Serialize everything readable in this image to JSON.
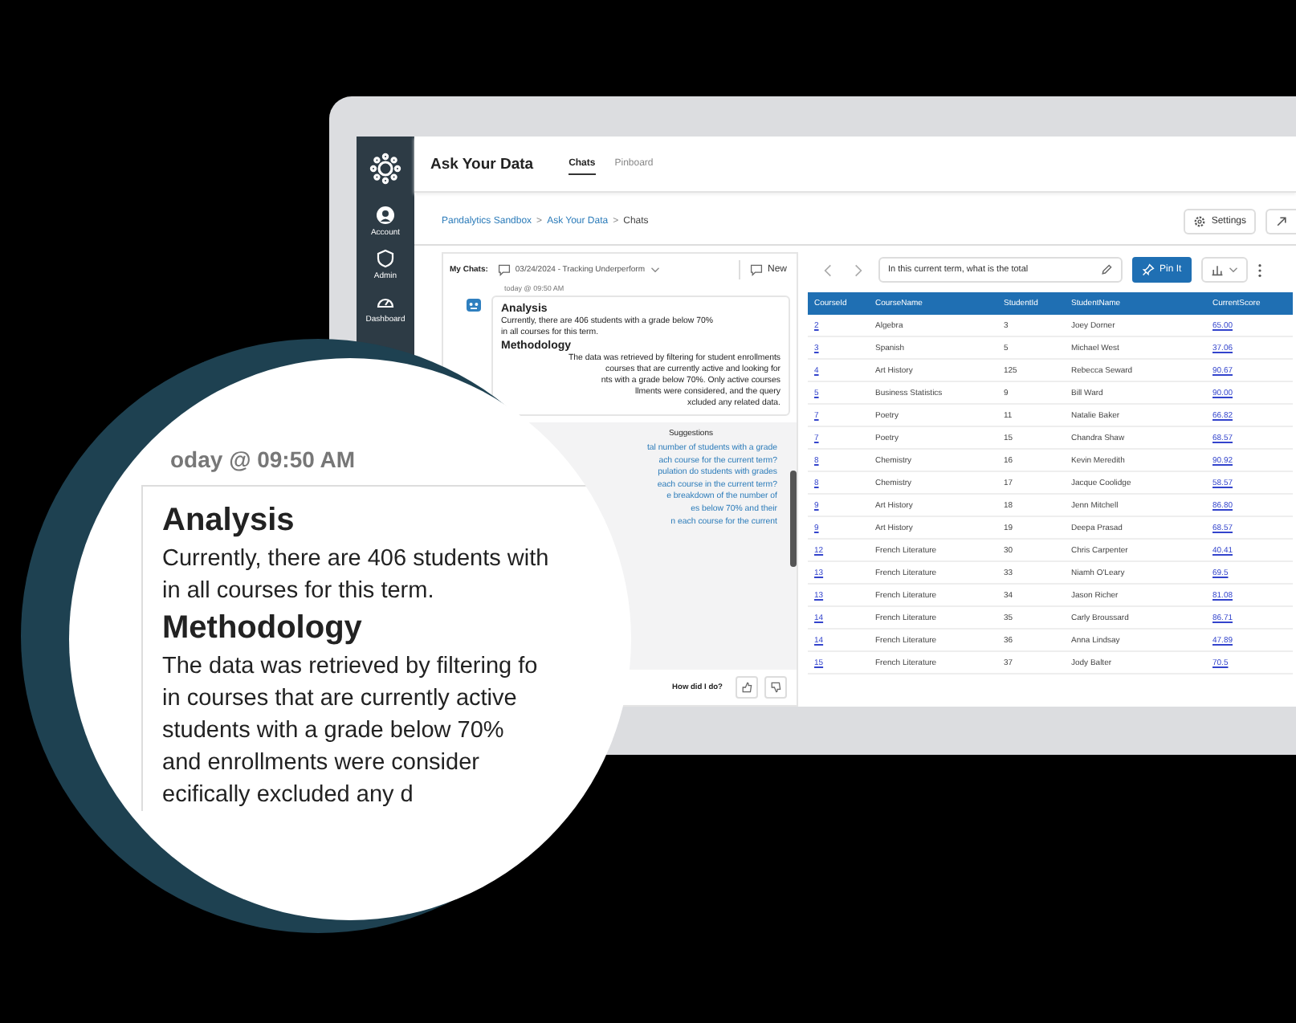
{
  "sidebar": {
    "items": [
      {
        "label": "Account",
        "kind": "account"
      },
      {
        "label": "Admin",
        "kind": "admin"
      },
      {
        "label": "Dashboard",
        "kind": "dashboard"
      }
    ]
  },
  "header": {
    "title": "Ask Your Data",
    "tabs": [
      {
        "label": "Chats",
        "selected": true
      },
      {
        "label": "Pinboard",
        "selected": false
      }
    ]
  },
  "breadcrumb": {
    "items": [
      "Pandalytics Sandbox",
      "Ask Your Data",
      "Chats"
    ],
    "separator": ">"
  },
  "settings_button": "Settings",
  "chat_panel": {
    "label": "My Chats:",
    "chat_select": "03/24/2024 - Tracking Underperform",
    "new_button": "New",
    "timestamp": "today @ 09:50 AM",
    "sections": [
      {
        "title": "Analysis",
        "lines": [
          "Currently, there are 406 students with a grade below 70%",
          "in all courses for this term."
        ]
      },
      {
        "title": "Methodology",
        "lines": [
          "The data was retrieved by filtering for student enrollments",
          "courses that are currently active and looking for",
          "nts with a grade below 70%. Only active courses",
          "llments were considered, and the query",
          "xcluded any related data."
        ]
      }
    ],
    "suggestions": {
      "title": "Suggestions",
      "lines": [
        "tal number of students with a grade",
        "ach course for the current term?",
        "pulation do students with grades",
        "each course in the current term?",
        "e breakdown of the number of",
        "es below 70% and their",
        "n each course for the current"
      ]
    },
    "feedback": "How did I do?"
  },
  "query_panel": {
    "query": "In this current term, what is the total",
    "pin_button": "Pin It",
    "table": {
      "columns": [
        "CourseId",
        "CourseName",
        "StudentId",
        "StudentName",
        "CurrentScore"
      ],
      "rows": [
        [
          "2",
          "Algebra",
          "3",
          "Joey Dorner",
          "65.00"
        ],
        [
          "3",
          "Spanish",
          "5",
          "Michael West",
          "37.06"
        ],
        [
          "4",
          "Art History",
          "125",
          "Rebecca Seward",
          "90.67"
        ],
        [
          "5",
          "Business Statistics",
          "9",
          "Bill Ward",
          "90.00"
        ],
        [
          "7",
          "Poetry",
          "11",
          "Natalie Baker",
          "66.82"
        ],
        [
          "7",
          "Poetry",
          "15",
          "Chandra Shaw",
          "68.57"
        ],
        [
          "8",
          "Chemistry",
          "16",
          "Kevin Meredith",
          "90.92"
        ],
        [
          "8",
          "Chemistry",
          "17",
          "Jacque Coolidge",
          "58.57"
        ],
        [
          "9",
          "Art History",
          "18",
          "Jenn Mitchell",
          "86.80"
        ],
        [
          "9",
          "Art History",
          "19",
          "Deepa Prasad",
          "68.57"
        ],
        [
          "12",
          "French Literature",
          "30",
          "Chris Carpenter",
          "40.41"
        ],
        [
          "13",
          "French Literature",
          "33",
          "Niamh O'Leary",
          "69.5"
        ],
        [
          "13",
          "French Literature",
          "34",
          "Jason Richer",
          "81.08"
        ],
        [
          "14",
          "French Literature",
          "35",
          "Carly Broussard",
          "86.71"
        ],
        [
          "14",
          "French Literature",
          "36",
          "Anna Lindsay",
          "47.89"
        ],
        [
          "15",
          "French Literature",
          "37",
          "Jody Balter",
          "70.5"
        ]
      ]
    }
  },
  "magnifier": {
    "timestamp": "oday @ 09:50 AM",
    "sections": [
      {
        "title": "Analysis",
        "lines": [
          "Currently, there are 406 students with",
          "in all courses for this term."
        ]
      },
      {
        "title": "Methodology",
        "lines": [
          "The data was retrieved by filtering fo",
          "in courses that are currently active",
          "students with a grade below 70%",
          "and enrollments were consider",
          "ecifically excluded any d"
        ]
      }
    ]
  }
}
